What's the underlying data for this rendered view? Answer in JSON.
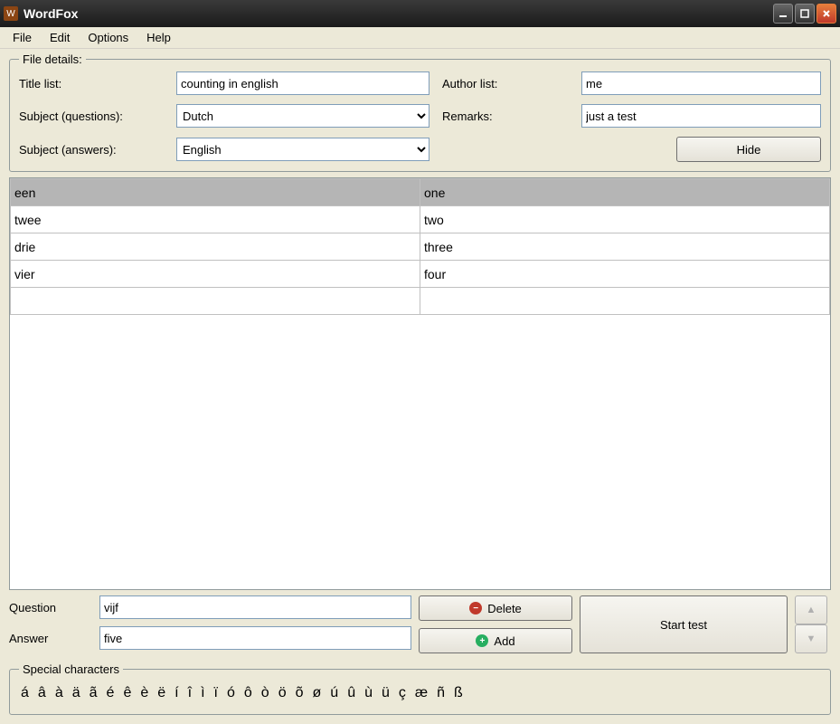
{
  "window": {
    "title": "WordFox"
  },
  "menubar": {
    "items": [
      "File",
      "Edit",
      "Options",
      "Help"
    ]
  },
  "file_details": {
    "legend": "File details:",
    "title_label": "Title list:",
    "title_value": "counting in english",
    "author_label": "Author list:",
    "author_value": "me",
    "subject_q_label": "Subject (questions):",
    "subject_q_value": "Dutch",
    "remarks_label": "Remarks:",
    "remarks_value": "just a test",
    "subject_a_label": "Subject (answers):",
    "subject_a_value": "English",
    "hide_label": "Hide"
  },
  "word_table": {
    "rows": [
      {
        "q": "een",
        "a": "one",
        "selected": true
      },
      {
        "q": "twee",
        "a": "two",
        "selected": false
      },
      {
        "q": "drie",
        "a": "three",
        "selected": false
      },
      {
        "q": "vier",
        "a": "four",
        "selected": false
      },
      {
        "q": "",
        "a": "",
        "selected": false
      }
    ]
  },
  "entry": {
    "question_label": "Question",
    "question_value": "vijf",
    "answer_label": "Answer",
    "answer_value": "five",
    "delete_label": "Delete",
    "add_label": "Add",
    "start_label": "Start test"
  },
  "special": {
    "legend": "Special characters",
    "chars": [
      "á",
      "â",
      "à",
      "ä",
      "ã",
      "é",
      "ê",
      "è",
      "ë",
      "í",
      "î",
      "ì",
      "ï",
      "ó",
      "ô",
      "ò",
      "ö",
      "õ",
      "ø",
      "ú",
      "û",
      "ù",
      "ü",
      "ç",
      "æ",
      "ñ",
      "ß"
    ]
  }
}
